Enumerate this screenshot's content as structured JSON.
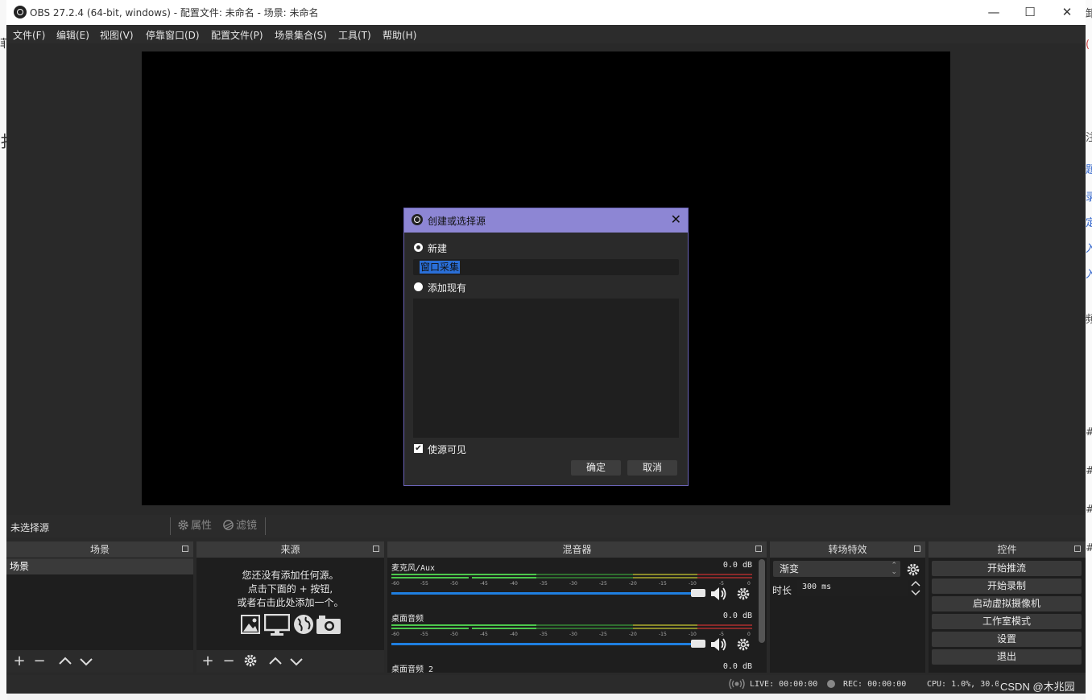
{
  "window": {
    "title": "OBS 27.2.4 (64-bit, windows) - 配置文件: 未命名 - 场景: 未命名",
    "minimize": "—",
    "maximize": "☐",
    "close": "✕"
  },
  "menu": [
    "文件(F)",
    "编辑(E)",
    "视图(V)",
    "停靠窗口(D)",
    "配置文件(P)",
    "场景集合(S)",
    "工具(T)",
    "帮助(H)"
  ],
  "source_bar": {
    "no_selection": "未选择源",
    "properties": "属性",
    "filters": "滤镜"
  },
  "scenes": {
    "title": "场景",
    "items": [
      "场景"
    ]
  },
  "sources": {
    "title": "来源",
    "empty_line1": "您还没有添加任何源。",
    "empty_line2": "点击下面的 + 按钮,",
    "empty_line3": "或者右击此处添加一个。"
  },
  "mixer": {
    "title": "混音器",
    "channels": [
      {
        "name": "麦克风/Aux",
        "db": "0.0 dB"
      },
      {
        "name": "桌面音频",
        "db": "0.0 dB"
      },
      {
        "name": "桌面音频 2",
        "db": "0.0 dB"
      }
    ],
    "ticks": [
      "-60",
      "-55",
      "-50",
      "-45",
      "-40",
      "-35",
      "-30",
      "-25",
      "-20",
      "-15",
      "-10",
      "-5",
      "0"
    ]
  },
  "transitions": {
    "title": "转场特效",
    "selected": "渐变",
    "duration_label": "时长",
    "duration_value": "300 ms"
  },
  "controls": {
    "title": "控件",
    "buttons": [
      "开始推流",
      "开始录制",
      "启动虚拟摄像机",
      "工作室模式",
      "设置",
      "退出"
    ]
  },
  "status": {
    "live": "LIVE: 00:00:00",
    "rec": "REC: 00:00:00",
    "cpu": "CPU: 1.0%, 30.00 fps",
    "watermark": "CSDN @木兆园"
  },
  "dialog": {
    "title": "创建或选择源",
    "new_label": "新建",
    "name_value": "窗口采集",
    "existing_label": "添加现有",
    "visible_label": "使源可见",
    "ok": "确定",
    "cancel": "取消"
  },
  "colors": {
    "meter_green": "#4cc84c",
    "meter_green_dim": "#2f6f2f",
    "meter_yellow": "#8a8a2a",
    "meter_red": "#8a2a2a",
    "fader_blue": "#1f7fe0",
    "dialog_title": "#8d86d4"
  }
}
